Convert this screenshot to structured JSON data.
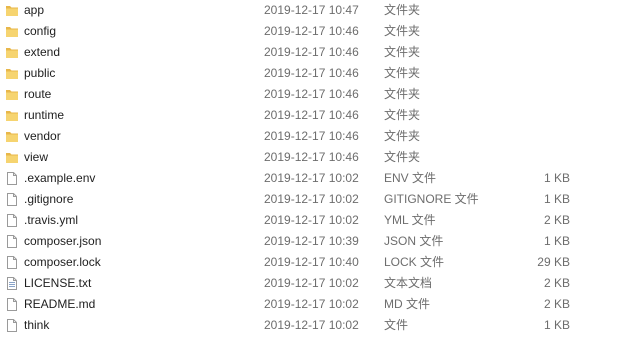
{
  "files": [
    {
      "name": "app",
      "modified": "2019-12-17 10:47",
      "type": "文件夹",
      "size": "",
      "icon": "folder-icon"
    },
    {
      "name": "config",
      "modified": "2019-12-17 10:46",
      "type": "文件夹",
      "size": "",
      "icon": "folder-icon"
    },
    {
      "name": "extend",
      "modified": "2019-12-17 10:46",
      "type": "文件夹",
      "size": "",
      "icon": "folder-icon"
    },
    {
      "name": "public",
      "modified": "2019-12-17 10:46",
      "type": "文件夹",
      "size": "",
      "icon": "folder-icon"
    },
    {
      "name": "route",
      "modified": "2019-12-17 10:46",
      "type": "文件夹",
      "size": "",
      "icon": "folder-icon"
    },
    {
      "name": "runtime",
      "modified": "2019-12-17 10:46",
      "type": "文件夹",
      "size": "",
      "icon": "folder-icon"
    },
    {
      "name": "vendor",
      "modified": "2019-12-17 10:46",
      "type": "文件夹",
      "size": "",
      "icon": "folder-icon"
    },
    {
      "name": "view",
      "modified": "2019-12-17 10:46",
      "type": "文件夹",
      "size": "",
      "icon": "folder-icon"
    },
    {
      "name": ".example.env",
      "modified": "2019-12-17 10:02",
      "type": "ENV 文件",
      "size": "1 KB",
      "icon": "file-icon"
    },
    {
      "name": ".gitignore",
      "modified": "2019-12-17 10:02",
      "type": "GITIGNORE 文件",
      "size": "1 KB",
      "icon": "file-icon"
    },
    {
      "name": ".travis.yml",
      "modified": "2019-12-17 10:02",
      "type": "YML 文件",
      "size": "2 KB",
      "icon": "file-icon"
    },
    {
      "name": "composer.json",
      "modified": "2019-12-17 10:39",
      "type": "JSON 文件",
      "size": "1 KB",
      "icon": "file-icon"
    },
    {
      "name": "composer.lock",
      "modified": "2019-12-17 10:40",
      "type": "LOCK 文件",
      "size": "29 KB",
      "icon": "file-icon"
    },
    {
      "name": "LICENSE.txt",
      "modified": "2019-12-17 10:02",
      "type": "文本文档",
      "size": "2 KB",
      "icon": "text-document-icon"
    },
    {
      "name": "README.md",
      "modified": "2019-12-17 10:02",
      "type": "MD 文件",
      "size": "2 KB",
      "icon": "file-icon"
    },
    {
      "name": "think",
      "modified": "2019-12-17 10:02",
      "type": "文件",
      "size": "1 KB",
      "icon": "file-icon"
    }
  ],
  "colors": {
    "folder": "#e8b74a",
    "folder_front": "#f6d470",
    "file_border": "#9a9a9a",
    "secondary_text": "#6d6d6d"
  }
}
